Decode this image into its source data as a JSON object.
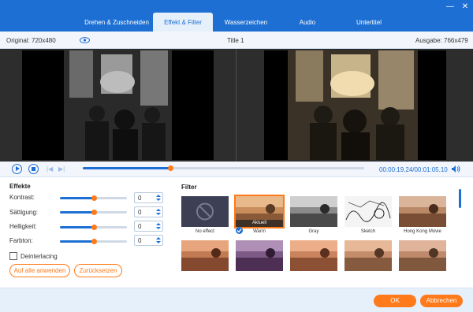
{
  "window": {
    "minimize_glyph": "—",
    "close_glyph": "✕",
    "accent_color": "#1d6fd3",
    "highlight_color": "#ff7a1a"
  },
  "tabs": [
    {
      "label": "Drehen & Zuschneiden",
      "active": false
    },
    {
      "label": "Effekt & Filter",
      "active": true
    },
    {
      "label": "Wasserzeichen",
      "active": false
    },
    {
      "label": "Audio",
      "active": false
    },
    {
      "label": "Untertitel",
      "active": false
    }
  ],
  "infobar": {
    "original": "Original: 720x480",
    "title": "Title 1",
    "output": "Ausgabe: 766x479"
  },
  "playback": {
    "time": "00:00:19.24/00:01:05.10",
    "progress_fraction": 0.31,
    "icons": [
      "play-icon",
      "stop-icon",
      "skip-back-icon",
      "skip-forward-icon",
      "volume-icon"
    ]
  },
  "effects": {
    "title": "Effekte",
    "params": [
      {
        "label": "Kontrast:",
        "value": "0",
        "level": 0.5
      },
      {
        "label": "Sättigung:",
        "value": "0",
        "level": 0.5
      },
      {
        "label": "Helligkeit:",
        "value": "0",
        "level": 0.5
      },
      {
        "label": "Farbton:",
        "value": "0",
        "level": 0.5
      }
    ],
    "deinterlacing_label": "Deinterlacing",
    "deinterlacing_checked": false,
    "apply_all_label": "Auf alle anwenden",
    "reset_label": "Zurücksetzen"
  },
  "filters": {
    "title": "Filter",
    "current_badge": "Aktuell",
    "items": [
      {
        "label": "No effect",
        "style": "none"
      },
      {
        "label": "Warm",
        "style": "warm",
        "selected": true
      },
      {
        "label": "Gray",
        "style": "gray"
      },
      {
        "label": "Sketch",
        "style": "sketch"
      },
      {
        "label": "Hong Kong Movie",
        "style": "hk"
      },
      {
        "label": "",
        "style": "warm2"
      },
      {
        "label": "",
        "style": "purple"
      },
      {
        "label": "",
        "style": "warm3"
      },
      {
        "label": "",
        "style": "warm4"
      },
      {
        "label": "",
        "style": "warm5"
      }
    ]
  },
  "footer": {
    "ok_label": "OK",
    "cancel_label": "Abbrechen"
  }
}
